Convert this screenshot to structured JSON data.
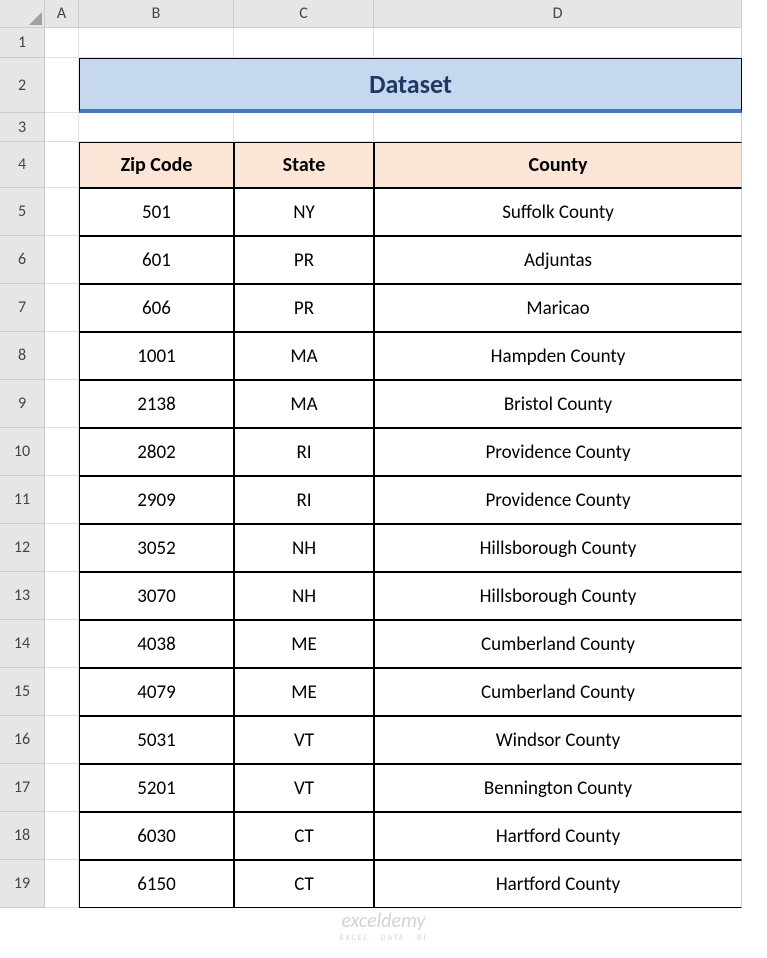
{
  "columns": [
    "A",
    "B",
    "C",
    "D"
  ],
  "rows": [
    "1",
    "2",
    "3",
    "4",
    "5",
    "6",
    "7",
    "8",
    "9",
    "10",
    "11",
    "12",
    "13",
    "14",
    "15",
    "16",
    "17",
    "18",
    "19"
  ],
  "title": "Dataset",
  "headers": {
    "zip": "Zip Code",
    "state": "State",
    "county": "County"
  },
  "data": [
    {
      "zip": "501",
      "state": "NY",
      "county": "Suffolk County"
    },
    {
      "zip": "601",
      "state": "PR",
      "county": "Adjuntas"
    },
    {
      "zip": "606",
      "state": "PR",
      "county": "Maricao"
    },
    {
      "zip": "1001",
      "state": "MA",
      "county": "Hampden County"
    },
    {
      "zip": "2138",
      "state": "MA",
      "county": "Bristol County"
    },
    {
      "zip": "2802",
      "state": "RI",
      "county": "Providence County"
    },
    {
      "zip": "2909",
      "state": "RI",
      "county": "Providence County"
    },
    {
      "zip": "3052",
      "state": "NH",
      "county": "Hillsborough County"
    },
    {
      "zip": "3070",
      "state": "NH",
      "county": "Hillsborough County"
    },
    {
      "zip": "4038",
      "state": "ME",
      "county": "Cumberland County"
    },
    {
      "zip": "4079",
      "state": "ME",
      "county": "Cumberland County"
    },
    {
      "zip": "5031",
      "state": "VT",
      "county": "Windsor County"
    },
    {
      "zip": "5201",
      "state": "VT",
      "county": "Bennington County"
    },
    {
      "zip": "6030",
      "state": "CT",
      "county": "Hartford County"
    },
    {
      "zip": "6150",
      "state": "CT",
      "county": "Hartford County"
    }
  ],
  "watermark": {
    "main": "exceldemy",
    "sub": "EXCEL · DATA · BI"
  }
}
